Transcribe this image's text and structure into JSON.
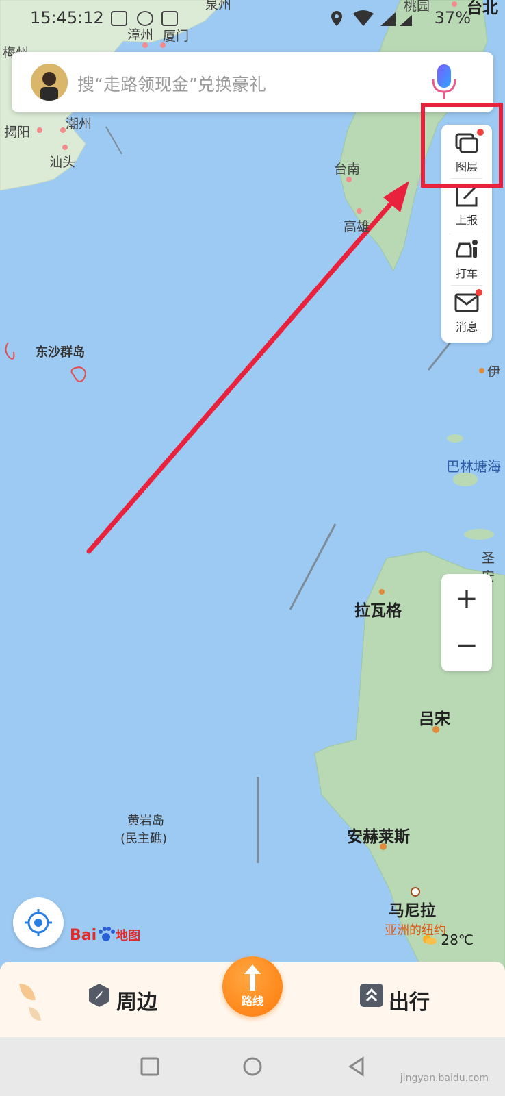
{
  "status_bar": {
    "time": "15:45:12",
    "battery": "37%"
  },
  "search": {
    "placeholder": "搜“走路领现金”兑换豪礼"
  },
  "side_panel": {
    "layers_label": "图层",
    "report_label": "上报",
    "taxi_label": "打车",
    "message_label": "消息"
  },
  "zoom": {
    "in": "+",
    "out": "−"
  },
  "map_labels": {
    "quanzhou": "泉州",
    "zhangzhou": "漳州",
    "xiamen": "厦门",
    "meizhou": "梅州",
    "chaozhou": "潮州",
    "jieyang": "揭阳",
    "shantou": "汕头",
    "taoyuan": "桃园",
    "taibei": "台北",
    "tainan": "台南",
    "gaoxiong": "高雄",
    "dongsha": "东沙群岛",
    "yi": "伊",
    "balintang": "巴林塘海",
    "shengan": "圣安",
    "lawag": "拉瓦格",
    "luzon": "吕宋",
    "huangyan1": "黄岩岛",
    "huangyan2": "(民主礁)",
    "angeles": "安赫莱斯",
    "manila": "马尼拉",
    "asia_nyc": "亚洲的纽约"
  },
  "weather": {
    "temp": "28℃"
  },
  "logo": {
    "text": "Bai",
    "text2": "地图"
  },
  "bottom_nav": {
    "nearby": "周边",
    "route": "路线",
    "travel": "出行"
  },
  "watermark": {
    "text": "jingyan.baidu.com"
  }
}
